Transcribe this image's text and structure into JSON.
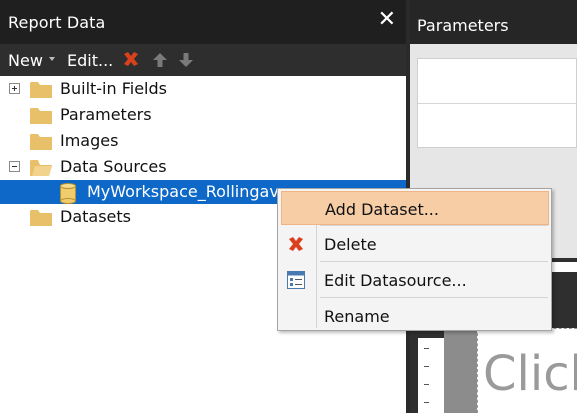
{
  "report_data": {
    "title": "Report Data",
    "close_glyph": "✕",
    "toolbar": {
      "new_label": "New",
      "edit_label": "Edit...",
      "delete_icon": "delete-x-icon",
      "up_icon": "move-up-arrow-icon",
      "down_icon": "move-down-arrow-icon"
    },
    "tree": [
      {
        "label": "Built-in Fields",
        "expander": "plus",
        "icon": "folder-icon"
      },
      {
        "label": "Parameters",
        "expander": "none",
        "icon": "folder-icon"
      },
      {
        "label": "Images",
        "expander": "none",
        "icon": "folder-icon"
      },
      {
        "label": "Data Sources",
        "expander": "minus",
        "icon": "folder-open-icon"
      },
      {
        "label": "MyWorkspace_Rollingave",
        "expander": "none",
        "icon": "database-icon",
        "selected": true
      },
      {
        "label": "Datasets",
        "expander": "none",
        "icon": "folder-icon"
      }
    ]
  },
  "parameters_pane": {
    "title": "Parameters"
  },
  "design_surface": {
    "placeholder_text": "Click"
  },
  "context_menu": {
    "items": [
      {
        "label": "Add Dataset...",
        "icon": "",
        "highlighted": true
      },
      {
        "label": "Delete",
        "icon": "delete-x-icon"
      },
      {
        "label": "Edit Datasource...",
        "icon": "properties-icon"
      },
      {
        "label": "Rename",
        "icon": ""
      }
    ]
  },
  "colors": {
    "header_bg": "#1f1f1f",
    "toolbar_bg": "#2e2e2e",
    "selection_bg": "#0d68c8",
    "menu_highlight": "#f7cda6",
    "delete_red": "#d9411e",
    "folder_yellow": "#e8c06a"
  }
}
